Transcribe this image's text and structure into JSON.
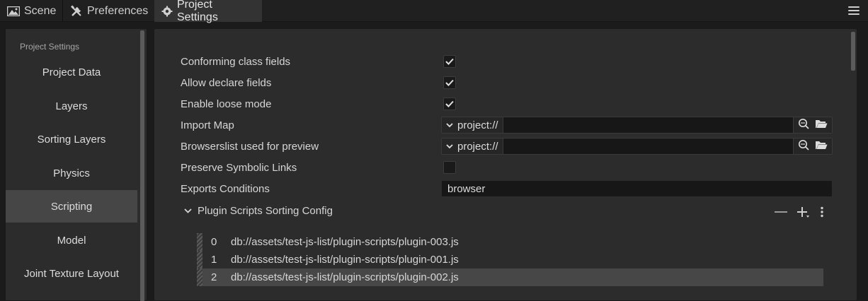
{
  "tabs": [
    {
      "label": "Scene",
      "icon": "image-icon"
    },
    {
      "label": "Preferences",
      "icon": "tools-icon"
    },
    {
      "label": "Project Settings",
      "icon": "gear-icon",
      "active": true
    }
  ],
  "sidebar": {
    "title": "Project Settings",
    "items": [
      {
        "label": "Project Data"
      },
      {
        "label": "Layers"
      },
      {
        "label": "Sorting Layers"
      },
      {
        "label": "Physics"
      },
      {
        "label": "Scripting",
        "selected": true
      },
      {
        "label": "Model"
      },
      {
        "label": "Joint Texture Layout"
      }
    ]
  },
  "settings": {
    "conforming_class_fields": {
      "label": "Conforming class fields",
      "checked": true
    },
    "allow_declare_fields": {
      "label": "Allow declare fields",
      "checked": true
    },
    "enable_loose_mode": {
      "label": "Enable loose mode",
      "checked": true
    },
    "import_map": {
      "label": "Import Map",
      "protocol": "project://",
      "value": ""
    },
    "browserslist": {
      "label": "Browserslist used for preview",
      "protocol": "project://",
      "value": ""
    },
    "preserve_symbolic_links": {
      "label": "Preserve Symbolic Links",
      "checked": false
    },
    "exports_conditions": {
      "label": "Exports Conditions",
      "value": "browser"
    }
  },
  "plugin_scripts": {
    "title": "Plugin Scripts Sorting Config",
    "items": [
      {
        "index": "0",
        "path": "db://assets/test-js-list/plugin-scripts/plugin-003.js"
      },
      {
        "index": "1",
        "path": "db://assets/test-js-list/plugin-scripts/plugin-001.js"
      },
      {
        "index": "2",
        "path": "db://assets/test-js-list/plugin-scripts/plugin-002.js",
        "selected": true
      }
    ]
  },
  "colors": {
    "accent": "#464646",
    "background": "#1b1b1b",
    "panel": "#2c2c2c"
  }
}
